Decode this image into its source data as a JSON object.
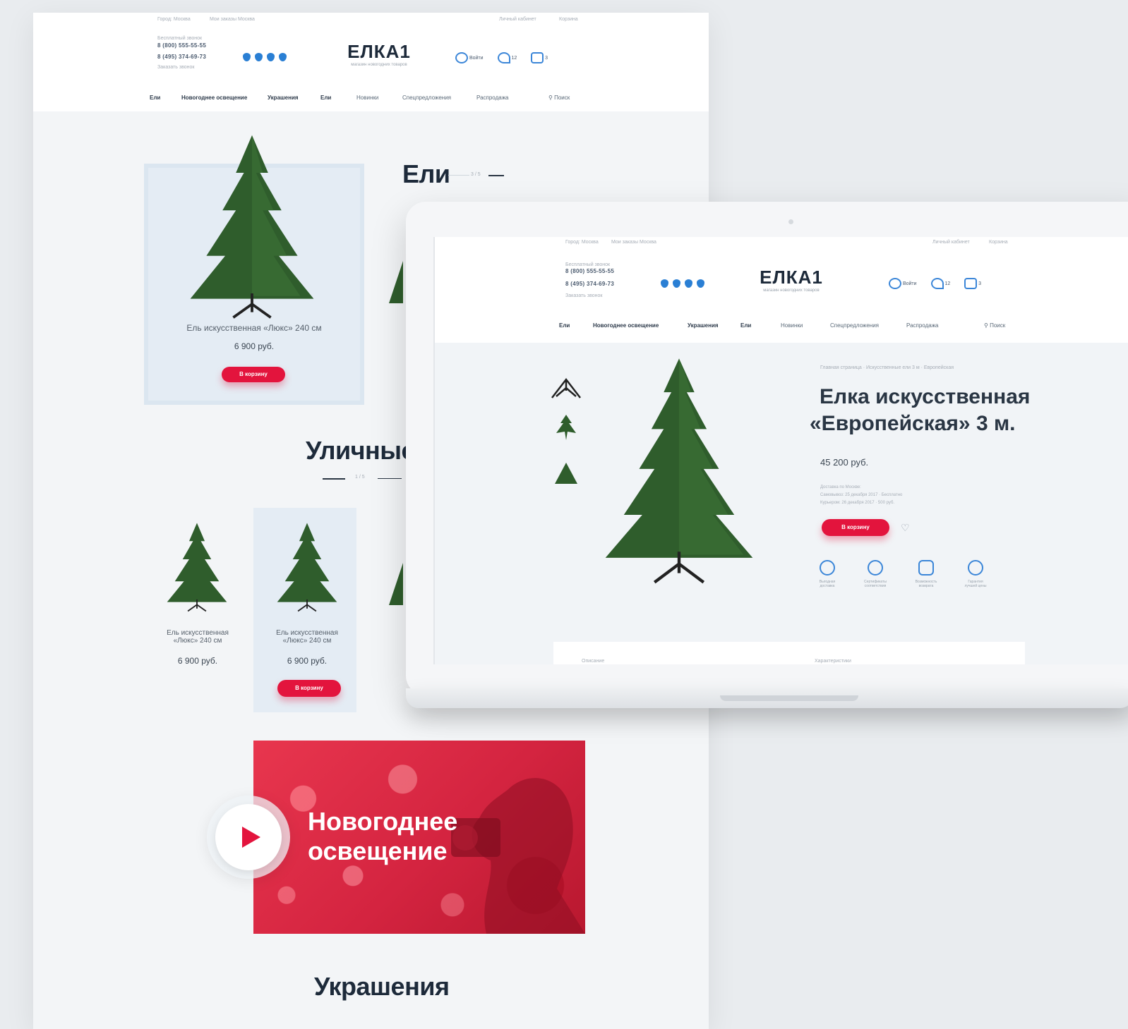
{
  "back_page": {
    "topbar": {
      "left": [
        "Город: Москва",
        "Мои заказы Москва"
      ],
      "right": [
        "Личный кабинет",
        "Корзина"
      ]
    },
    "phones": {
      "label_top": "Бесплатный звонок",
      "phone1": "8 (800) 555-55-55",
      "phone2": "8 (495) 374-69-73",
      "label_bottom": "Заказать звонок"
    },
    "logo": "ЕЛКА1",
    "tagline": "магазин новогодних товаров",
    "header_icons": [
      {
        "icon": "user-icon",
        "label": "Войти"
      },
      {
        "icon": "heart-icon",
        "label": "12"
      },
      {
        "icon": "cart-icon",
        "label": "3"
      }
    ],
    "nav": [
      "Ели",
      "Новогоднее освещение",
      "Украшения",
      "Ели",
      "Новинки",
      "Спецпредложения",
      "Распродажа"
    ],
    "search_label": "Поиск",
    "section_eli": {
      "title": "Ели",
      "pager": "3 / 5"
    },
    "featured": {
      "name": "Ель искусственная «Люкс» 240 см",
      "price": "6 900 руб.",
      "button": "В корзину"
    },
    "section_street": {
      "title": "Уличные ели",
      "pager": "1 / 5"
    },
    "street_products": [
      {
        "name": "Ель искусственная «Люкс» 240 см",
        "price": "6 900 руб."
      },
      {
        "name": "Ель искусственная «Люкс» 240 см",
        "price": "6 900 руб.",
        "button": "В корзину"
      }
    ],
    "banner": {
      "title_line1": "Новогоднее",
      "title_line2": "освещение"
    },
    "section_decor": {
      "title": "Украшения"
    }
  },
  "laptop_page": {
    "topbar": {
      "left": [
        "Город: Москва",
        "Мои заказы Москва"
      ],
      "right": [
        "Личный кабинет",
        "Корзина"
      ]
    },
    "phones": {
      "label_top": "Бесплатный звонок",
      "phone1": "8 (800) 555-55-55",
      "phone2": "8 (495) 374-69-73",
      "label_bottom": "Заказать звонок"
    },
    "logo": "ЕЛКА1",
    "tagline": "магазин новогодних товаров",
    "header_icons": [
      {
        "icon": "user-icon",
        "label": "Войти"
      },
      {
        "icon": "heart-icon",
        "label": "12"
      },
      {
        "icon": "cart-icon",
        "label": "3"
      }
    ],
    "nav": [
      "Ели",
      "Новогоднее освещение",
      "Украшения",
      "Ели",
      "Новинки",
      "Спецпредложения",
      "Распродажа"
    ],
    "search_label": "Поиск",
    "breadcrumb": "Главная страница · Искусственные ели 3 м · Европейская",
    "product": {
      "title_line1": "Елка искусственная",
      "title_line2": "«Европейская» 3 м.",
      "price": "45 200 руб.",
      "delivery": [
        "Доставка по Москве:",
        "Самовывоз: 25 декабря 2017 · Бесплатно",
        "Курьером: 26 декабря 2017 · 500 руб."
      ],
      "button": "В корзину"
    },
    "features": [
      {
        "icon": "ornament-icon",
        "label": "Выгодная доставка"
      },
      {
        "icon": "badge-icon",
        "label": "Сертификаты соответствия"
      },
      {
        "icon": "bag-icon",
        "label": "Возможность возврата"
      },
      {
        "icon": "hand-icon",
        "label": "Гарантия лучшей цены"
      }
    ],
    "tabs": [
      "Описание",
      "Характеристики"
    ]
  }
}
